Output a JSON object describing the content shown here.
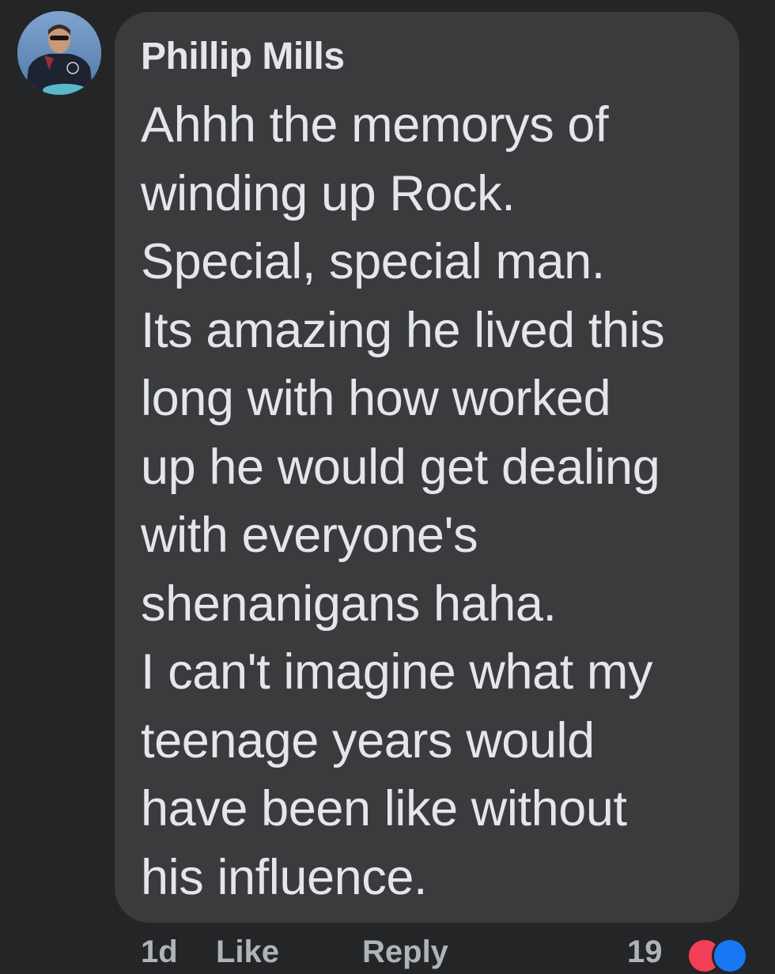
{
  "comment": {
    "author": "Phillip Mills",
    "text_lines": [
      "Ahhh the memorys of",
      "winding up Rock.",
      "Special, special man.",
      "Its amazing he lived this",
      "long with how worked",
      "up he would get dealing",
      "with everyone's",
      "shenanigans haha.",
      "I can't imagine what my",
      "teenage years would",
      "have been like without",
      "his influence."
    ]
  },
  "actions": {
    "time": "1d",
    "like_label": "Like",
    "reply_label": "Reply",
    "reaction_count": "19"
  },
  "colors": {
    "background": "#242526",
    "bubble": "#3a3b3c",
    "text": "#e4e6eb",
    "secondary_text": "#b0b3b8"
  },
  "icons": {
    "avatar": "profile-photo",
    "reactions": [
      "love-reaction-icon",
      "like-reaction-icon"
    ]
  }
}
